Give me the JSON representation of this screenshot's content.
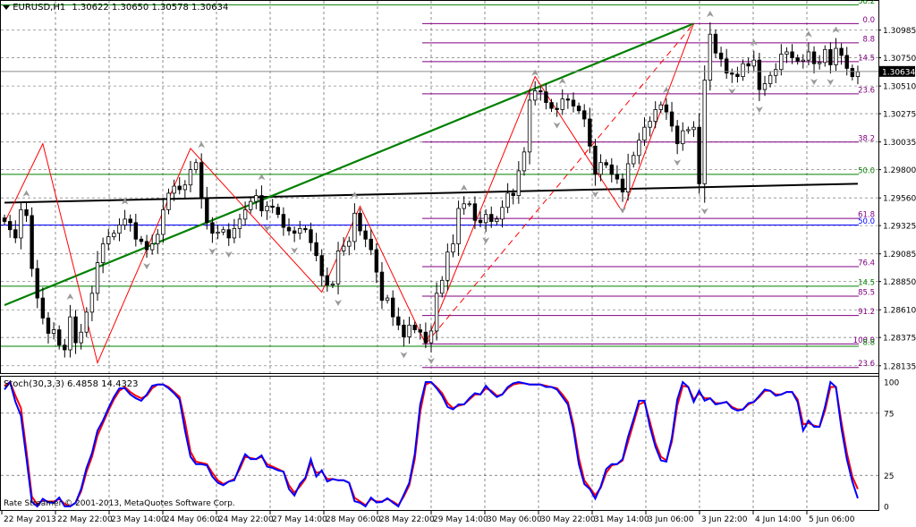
{
  "header": {
    "symbol": "EURUSD,H1",
    "ohlc": "1.30622 1.30650 1.30578 1.30634"
  },
  "price_axis": {
    "ticks": [
      "1.30985",
      "1.30750",
      "1.30510",
      "1.30275",
      "1.30035",
      "1.29800",
      "1.29560",
      "1.29325",
      "1.29085",
      "1.28850",
      "1.28610",
      "1.28375",
      "1.28135"
    ],
    "current_price": "1.30634"
  },
  "time_axis": {
    "labels": [
      "22 May 2013",
      "22 May 22:00",
      "23 May 14:00",
      "24 May 06:00",
      "24 May 22:00",
      "27 May 14:00",
      "28 May 06:00",
      "28 May 22:00",
      "29 May 14:00",
      "30 May 06:00",
      "30 May 22:00",
      "31 May 14:00",
      "3 Jun 06:00",
      "3 Jun 22:00",
      "4 Jun 14:00",
      "5 Jun 06:00"
    ]
  },
  "fibo_set_1": {
    "color": "#800080",
    "levels": [
      {
        "label": "0.0",
        "price": 1.3104
      },
      {
        "label": "8.8",
        "price": 1.30877
      },
      {
        "label": "14.5",
        "price": 1.30717
      },
      {
        "label": "23.6",
        "price": 1.30444
      },
      {
        "label": "38.2",
        "price": 1.30034
      },
      {
        "label": "61.8",
        "price": 1.29386
      },
      {
        "label": "76.4",
        "price": 1.28976
      },
      {
        "label": "85.5",
        "price": 1.28726
      },
      {
        "label": "91.2",
        "price": 1.28561
      },
      {
        "label": "100.0",
        "price": 1.2832
      },
      {
        "label": "23.6",
        "price": 1.2812
      }
    ]
  },
  "fibo_set_2": {
    "color": "#008000",
    "levels": [
      {
        "label": "38.2",
        "price": 1.312
      },
      {
        "label": "8.8",
        "price": 1.283
      },
      {
        "label": "14.5",
        "price": 1.2881
      },
      {
        "label": "50.0",
        "price": 1.2976
      }
    ]
  },
  "blue_level": {
    "label": "50.0",
    "price": 1.2933,
    "color": "#0000ff"
  },
  "stochastic": {
    "title": "Stoch(30,3,3) 6.4858 14.4323",
    "main_value": 6.4858,
    "signal_value": 14.4323,
    "main_color": "#0000ff",
    "signal_color": "#ff0000",
    "levels": [
      "100",
      "75",
      "25",
      "0"
    ]
  },
  "copyright": "Rate Streamer © 2001-2013, MetaQuotes Software Corp.",
  "chart_data": [
    {
      "type": "candlestick",
      "title": "EURUSD,H1",
      "ylim": [
        1.2808,
        1.3121
      ],
      "x_count": 157,
      "series": [
        {
          "name": "EURUSD close (approx.)",
          "values": [
            1.2936,
            1.2929,
            1.2922,
            1.2946,
            1.2941,
            1.2896,
            1.2871,
            1.2854,
            1.2841,
            1.2844,
            1.2831,
            1.2827,
            1.2855,
            1.2833,
            1.2842,
            1.2859,
            1.2875,
            1.2901,
            1.2917,
            1.2923,
            1.2926,
            1.2933,
            1.2938,
            1.2935,
            1.2921,
            1.2919,
            1.2912,
            1.2917,
            1.2925,
            1.2946,
            1.296,
            1.2966,
            1.2963,
            1.2967,
            1.298,
            1.2986,
            1.2956,
            1.2935,
            1.2926,
            1.2927,
            1.2929,
            1.2922,
            1.293,
            1.2938,
            1.2946,
            1.2953,
            1.2958,
            1.2945,
            1.2949,
            1.2948,
            1.2942,
            1.2931,
            1.2928,
            1.2926,
            1.293,
            1.2929,
            1.2918,
            1.2907,
            1.289,
            1.2882,
            1.2883,
            1.2911,
            1.2915,
            1.2919,
            1.2943,
            1.2928,
            1.2921,
            1.2912,
            1.2893,
            1.2869,
            1.2871,
            1.2855,
            1.2848,
            1.2838,
            1.2848,
            1.2844,
            1.2842,
            1.2833,
            1.2843,
            1.2875,
            1.2886,
            1.291,
            1.2917,
            1.2947,
            1.2951,
            1.2951,
            1.2937,
            1.2935,
            1.2942,
            1.2936,
            1.2938,
            1.2948,
            1.296,
            1.2958,
            1.2979,
            1.2995,
            1.3039,
            1.3047,
            1.3046,
            1.3037,
            1.3032,
            1.3031,
            1.304,
            1.3039,
            1.3034,
            1.303,
            1.3023,
            1.3,
            1.2976,
            1.2986,
            1.2984,
            1.2976,
            1.2972,
            1.2961,
            1.2985,
            1.2992,
            1.3005,
            1.3016,
            1.3021,
            1.3031,
            1.3035,
            1.3029,
            1.3017,
            1.3002,
            1.3013,
            1.3014,
            1.3016,
            1.2968,
            1.3056,
            1.3095,
            1.3079,
            1.3074,
            1.3062,
            1.3061,
            1.3059,
            1.307,
            1.3068,
            1.3073,
            1.3048,
            1.3053,
            1.306,
            1.3065,
            1.3078,
            1.308,
            1.3075,
            1.3072,
            1.3073,
            1.308,
            1.307,
            1.3071,
            1.3082,
            1.3069,
            1.3083,
            1.3077,
            1.3066,
            1.3059,
            1.3063
          ]
        }
      ]
    },
    {
      "type": "line",
      "title": "Stoch(30,3,3)",
      "ylim": [
        0,
        100
      ],
      "x_count": 157,
      "series": [
        {
          "name": "Stoch(30,3,3) main",
          "values": [
            94.0,
            100.0,
            84.0,
            73.0,
            39.0,
            3.6,
            0.0,
            6.1,
            3.2,
            2.9,
            7.1,
            0.0,
            0.0,
            2.9,
            14.0,
            31.0,
            43.0,
            61.0,
            69.0,
            79.0,
            88.0,
            95.0,
            95.0,
            90.0,
            87.0,
            85.0,
            90.0,
            97.0,
            98.0,
            98.0,
            95.0,
            91.0,
            86.0,
            61.0,
            40.0,
            34.0,
            34.0,
            33.0,
            24.0,
            19.0,
            17.0,
            20.0,
            21.0,
            32.0,
            42.0,
            38.0,
            38.0,
            41.0,
            32.0,
            31.0,
            29.0,
            28.0,
            14.0,
            8.8,
            18.0,
            23.0,
            38.0,
            24.0,
            29.0,
            20.0,
            22.0,
            21.0,
            21.0,
            19.0,
            4.2,
            2.9,
            0.0,
            7.1,
            3.2,
            3.6,
            6.6,
            3.1,
            0.0,
            9.4,
            19.0,
            42.0,
            82.0,
            100.0,
            100.0,
            95.0,
            89.0,
            80.0,
            78.0,
            82.0,
            82.0,
            87.0,
            91.0,
            90.0,
            97.0,
            92.0,
            88.0,
            90.0,
            96.0,
            99.0,
            100.0,
            99.0,
            98.0,
            98.0,
            98.0,
            96.0,
            96.0,
            94.0,
            88.0,
            82.0,
            62.0,
            34.0,
            18.0,
            14.0,
            6.3,
            16.0,
            30.0,
            34.0,
            34.0,
            38.0,
            56.0,
            70.0,
            85.0,
            85.0,
            64.0,
            48.0,
            37.0,
            36.0,
            55.0,
            86.0,
            100.0,
            96.0,
            84.0,
            93.0,
            85.0,
            87.0,
            82.0,
            83.0,
            84.0,
            79.0,
            77.0,
            78.0,
            83.0,
            84.0,
            89.0,
            94.0,
            93.0,
            89.0,
            90.0,
            92.0,
            92.0,
            84.0,
            61.0,
            69.0,
            64.0,
            64.0,
            80.0,
            100.0,
            96.0,
            63.0,
            38.0,
            20.0,
            6.5
          ]
        },
        {
          "name": "Stoch(30,3,3) signal",
          "values": [
            97.0,
            100.0,
            89.0,
            79.0,
            45.0,
            8.0,
            1.5,
            5.0,
            4.0,
            4.0,
            6.0,
            2.0,
            0.0,
            3.0,
            12.0,
            28.0,
            40.0,
            57.0,
            67.0,
            77.0,
            86.0,
            93.0,
            96.0,
            92.0,
            89.0,
            87.0,
            89.0,
            95.0,
            98.0,
            98.0,
            96.0,
            92.0,
            88.0,
            68.0,
            44.0,
            36.0,
            35.0,
            34.0,
            27.0,
            21.0,
            18.0,
            20.0,
            22.0,
            30.0,
            40.0,
            39.0,
            38.0,
            40.0,
            34.0,
            32.0,
            30.0,
            28.0,
            17.0,
            11.0,
            16.0,
            22.0,
            35.0,
            27.0,
            28.0,
            22.0,
            22.0,
            21.0,
            21.0,
            19.0,
            7.0,
            4.0,
            1.0,
            6.0,
            4.0,
            4.0,
            6.0,
            4.0,
            1.0,
            8.0,
            17.0,
            38.0,
            76.0,
            98.0,
            100.0,
            96.0,
            91.0,
            83.0,
            79.0,
            81.0,
            82.0,
            86.0,
            90.0,
            90.0,
            95.0,
            93.0,
            89.0,
            90.0,
            95.0,
            98.0,
            99.0,
            99.0,
            98.0,
            98.0,
            98.0,
            97.0,
            96.0,
            95.0,
            90.0,
            84.0,
            66.0,
            39.0,
            21.0,
            15.0,
            9.0,
            15.0,
            27.0,
            33.0,
            34.0,
            37.0,
            52.0,
            67.0,
            82.0,
            84.0,
            68.0,
            51.0,
            40.0,
            37.0,
            52.0,
            81.0,
            97.0,
            96.0,
            86.0,
            91.0,
            87.0,
            87.0,
            83.0,
            83.0,
            84.0,
            80.0,
            78.0,
            78.0,
            82.0,
            84.0,
            88.0,
            93.0,
            93.0,
            90.0,
            90.0,
            92.0,
            92.0,
            86.0,
            66.0,
            67.0,
            65.0,
            64.0,
            77.0,
            96.0,
            96.0,
            68.0,
            43.0,
            24.0,
            14.0
          ]
        }
      ]
    }
  ]
}
